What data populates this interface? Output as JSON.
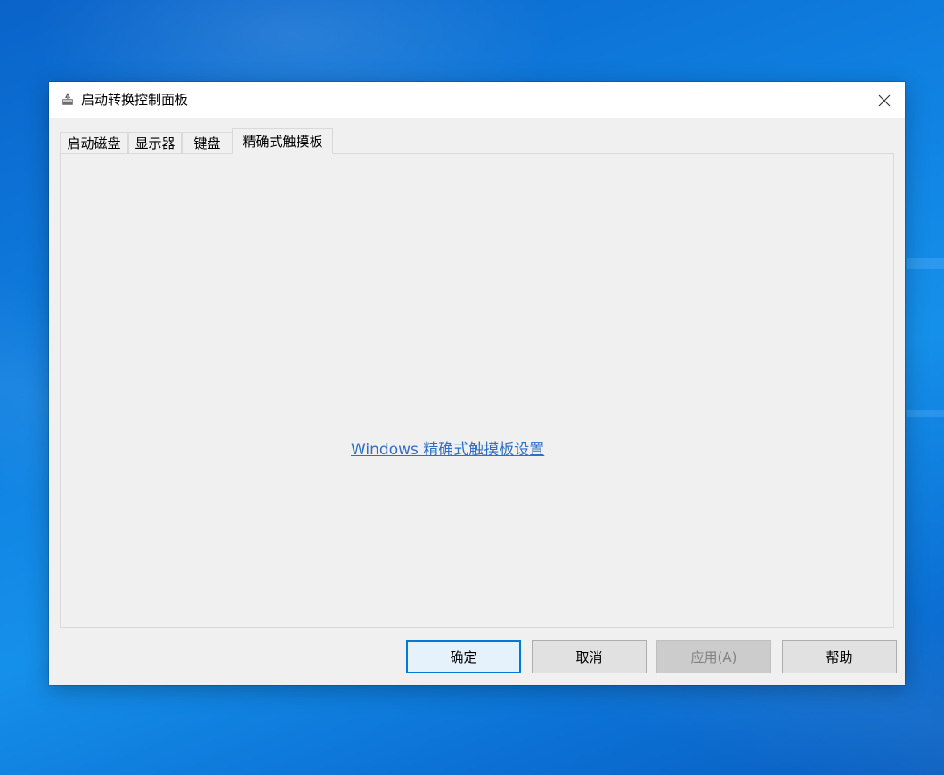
{
  "window": {
    "title": "启动转换控制面板",
    "icon": "bootcamp-drive-icon",
    "close_symbol": "✕"
  },
  "tabs": [
    {
      "label": "启动磁盘",
      "active": false
    },
    {
      "label": "显示器",
      "active": false
    },
    {
      "label": "键盘",
      "active": false
    },
    {
      "label": "精确式触摸板",
      "active": true
    }
  ],
  "panel": {
    "link_text": "Windows 精确式触摸板设置"
  },
  "buttons": {
    "ok": "确定",
    "cancel": "取消",
    "apply": "应用(A)",
    "help": "帮助"
  },
  "colors": {
    "link": "#2e6fc6",
    "accent": "#0078d7"
  }
}
